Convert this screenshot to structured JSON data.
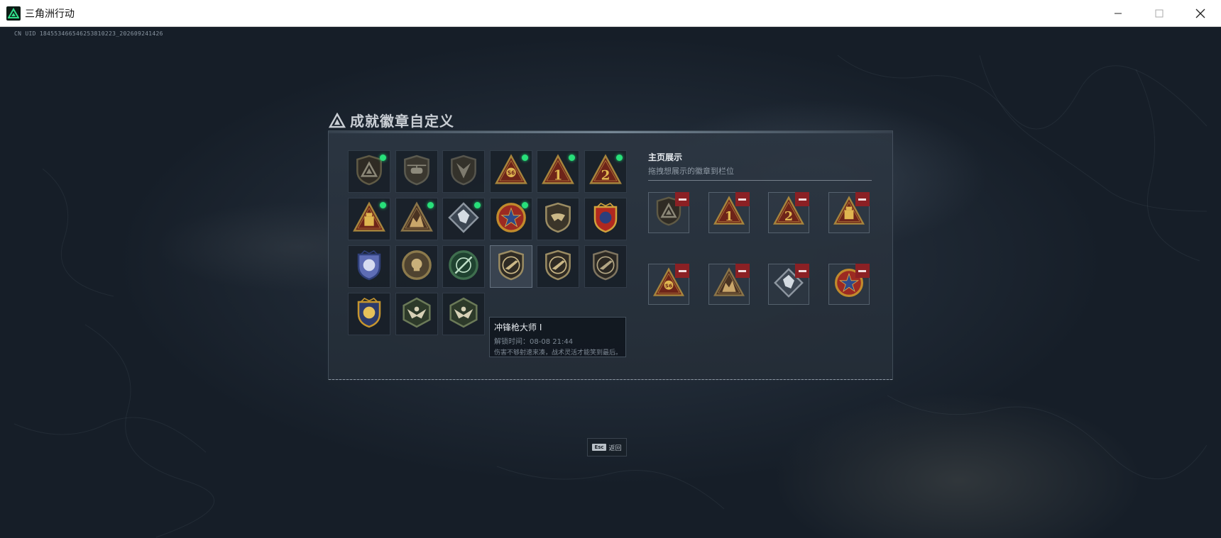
{
  "window": {
    "title": "三角洲行动",
    "controls": [
      "minimize",
      "maximize",
      "close"
    ]
  },
  "uid_text": "CN UID 18455346654625381022З_202609241426",
  "panel": {
    "title": "成就徽章自定义"
  },
  "badges": [
    {
      "icon": "shield-triangle-badge-icon",
      "new": true,
      "colors": {
        "rim": "#5f5a45",
        "fill": "#2f2b24",
        "emblem": "#8c8878"
      }
    },
    {
      "icon": "helicopter-badge-icon",
      "new": false,
      "colors": {
        "rim": "#5b5a4f",
        "fill": "#3a372f",
        "emblem": "#8d8a7c"
      }
    },
    {
      "icon": "arrowhead-badge-icon",
      "new": false,
      "colors": {
        "rim": "#56554d",
        "fill": "#34322b",
        "emblem": "#7d7a6e"
      }
    },
    {
      "icon": "rank-s6-triangle-badge-icon",
      "new": true,
      "colors": {
        "rim": "#a6843c",
        "fill": "#6e2419",
        "emblem": "#e0b650"
      }
    },
    {
      "icon": "rank-1-triangle-badge-icon",
      "new": true,
      "colors": {
        "rim": "#a6843c",
        "fill": "#6e2419",
        "emblem": "#e0b650"
      }
    },
    {
      "icon": "rank-2-triangle-badge-icon",
      "new": true,
      "colors": {
        "rim": "#a6843c",
        "fill": "#6e2419",
        "emblem": "#e0b650"
      }
    },
    {
      "icon": "vault-triangle-badge-icon",
      "new": true,
      "colors": {
        "rim": "#a6843c",
        "fill": "#6e2419",
        "emblem": "#e0b650"
      }
    },
    {
      "icon": "squad-triangle-badge-icon",
      "new": true,
      "colors": {
        "rim": "#8a7448",
        "fill": "#4a3322",
        "emblem": "#c9a66a"
      }
    },
    {
      "icon": "crystal-diamond-badge-icon",
      "new": true,
      "colors": {
        "rim": "#8d96a0",
        "fill": "#3c4652",
        "emblem": "#d4dbe2"
      }
    },
    {
      "icon": "star-medallion-badge-icon",
      "new": true,
      "colors": {
        "rim": "#c18b2c",
        "fill": "#9c2a22",
        "emblem": "#2e4b8a"
      }
    },
    {
      "icon": "wing-shield-badge-icon",
      "new": false,
      "colors": {
        "rim": "#9b8c63",
        "fill": "#3b3529",
        "emblem": "#cbb887"
      }
    },
    {
      "icon": "blue-crest-badge-icon",
      "new": false,
      "colors": {
        "rim": "#d0a23c",
        "fill": "#b0281f",
        "emblem": "#2b3f7c"
      }
    },
    {
      "icon": "eagle-crest-badge-icon",
      "new": false,
      "colors": {
        "rim": "#2f3f78",
        "fill": "#5e6db5",
        "emblem": "#d6dcf0"
      }
    },
    {
      "icon": "skull-roundel-badge-icon",
      "new": false,
      "colors": {
        "rim": "#8c7a4c",
        "fill": "#4f4330",
        "emblem": "#c9b07a"
      }
    },
    {
      "icon": "green-target-badge-icon",
      "new": false,
      "colors": {
        "rim": "#3f6e4e",
        "fill": "#1f4230",
        "emblem": "#bfe0c8"
      }
    },
    {
      "icon": "smg-shield-badge-icon",
      "new": false,
      "colors": {
        "rim": "#9b8c63",
        "fill": "#2f2b24",
        "emblem": "#cbb887"
      }
    },
    {
      "icon": "rifle-shield-badge-icon",
      "new": false,
      "colors": {
        "rim": "#9b8c63",
        "fill": "#2f2b24",
        "emblem": "#cbb887"
      }
    },
    {
      "icon": "pistol-shield-badge-icon",
      "new": false,
      "colors": {
        "rim": "#7f7560",
        "fill": "#2b2823",
        "emblem": "#b3a684"
      }
    },
    {
      "icon": "gold-crest-badge-icon",
      "new": false,
      "colors": {
        "rim": "#c6952e",
        "fill": "#2c3a6c",
        "emblem": "#e6c05a"
      }
    },
    {
      "icon": "eagle-hexagon-badge-icon",
      "new": false,
      "colors": {
        "rim": "#6b7a58",
        "fill": "#2d3a2a",
        "emblem": "#d7d1b6"
      }
    },
    {
      "icon": "eagle-hexagon-badge-icon",
      "new": false,
      "colors": {
        "rim": "#6b7a58",
        "fill": "#2d3a2a",
        "emblem": "#d7d1b6"
      }
    }
  ],
  "tooltip": {
    "name": "冲锋枪大师 I",
    "time": "解锁时间：08-08 21:44",
    "description": "伤害不够射速来凑，战术灵活才能笑到最后。"
  },
  "showcase": {
    "title": "主页展示",
    "subtitle": "拖拽想展示的徽章到栏位"
  },
  "slots": [
    {
      "icon": "shield-triangle-badge-icon",
      "badge_index": 0
    },
    {
      "icon": "rank-1-triangle-badge-icon",
      "badge_index": 4
    },
    {
      "icon": "rank-2-triangle-badge-icon",
      "badge_index": 5
    },
    {
      "icon": "vault-triangle-badge-icon",
      "badge_index": 6
    },
    {
      "icon": "rank-s6-triangle-badge-icon",
      "badge_index": 3
    },
    {
      "icon": "squad-triangle-badge-icon",
      "badge_index": 7
    },
    {
      "icon": "crystal-diamond-badge-icon",
      "badge_index": 8
    },
    {
      "icon": "star-medallion-badge-icon",
      "badge_index": 9
    }
  ],
  "esc_hint": {
    "key": "Esc",
    "label": "返回"
  },
  "colors": {
    "new_dot": "#28e07a",
    "remove_button": "#8b2024",
    "background": "#151d28"
  }
}
